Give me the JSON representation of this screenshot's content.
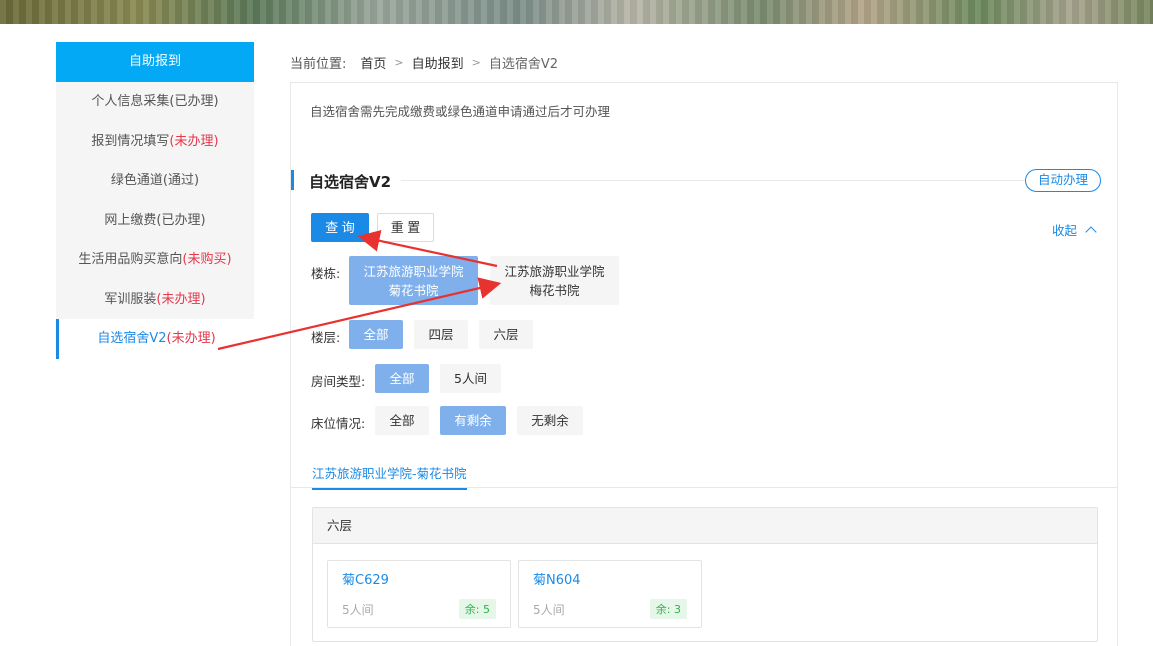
{
  "sidebar": {
    "header": "自助报到",
    "items": [
      {
        "label": "个人信息采集",
        "status": "(已办理)",
        "status_red": false
      },
      {
        "label": "报到情况填写",
        "status": "(未办理)",
        "status_red": true
      },
      {
        "label": "绿色通道",
        "status": "(通过)",
        "status_red": false
      },
      {
        "label": "网上缴费",
        "status": "(已办理)",
        "status_red": false
      },
      {
        "label": "生活用品购买意向",
        "status": "(未购买)",
        "status_red": true
      },
      {
        "label": "军训服装",
        "status": "(未办理)",
        "status_red": true
      },
      {
        "label": "自选宿舍V2",
        "status": "(未办理)",
        "status_red": true
      }
    ]
  },
  "breadcrumb": {
    "prefix": "当前位置:",
    "items": [
      "首页",
      "自助报到",
      "自选宿舍V2"
    ]
  },
  "notice": "自选宿舍需先完成缴费或绿色通道申请通过后才可办理",
  "section": {
    "title": "自选宿舍V2",
    "auto_button": "自动办理"
  },
  "actions": {
    "query": "查 询",
    "reset": "重 置",
    "collapse": "收起"
  },
  "filters": {
    "building": {
      "label": "楼栋:",
      "options": [
        {
          "line1": "江苏旅游职业学院",
          "line2": "菊花书院",
          "selected": true
        },
        {
          "line1": "江苏旅游职业学院",
          "line2": "梅花书院",
          "selected": false
        }
      ]
    },
    "floor": {
      "label": "楼层:",
      "options": [
        {
          "text": "全部",
          "selected": true
        },
        {
          "text": "四层",
          "selected": false
        },
        {
          "text": "六层",
          "selected": false
        }
      ]
    },
    "room_type": {
      "label": "房间类型:",
      "options": [
        {
          "text": "全部",
          "selected": true
        },
        {
          "text": "5人间",
          "selected": false
        }
      ]
    },
    "bed_status": {
      "label": "床位情况:",
      "options": [
        {
          "text": "全部",
          "selected": false
        },
        {
          "text": "有剩余",
          "selected": true
        },
        {
          "text": "无剩余",
          "selected": false
        }
      ]
    }
  },
  "result_tab": "江苏旅游职业学院-菊花书院",
  "floor_group": {
    "name": "六层",
    "rooms": [
      {
        "name": "菊C629",
        "type": "5人间",
        "free": "余: 5"
      },
      {
        "name": "菊N604",
        "type": "5人间",
        "free": "余: 3"
      }
    ]
  },
  "colors": {
    "primary": "#1b8ae6",
    "sidebar_header": "#03a9f4",
    "selected_chip": "#7fb0ec",
    "status_red": "#e6374b",
    "annotation_arrow": "#e8322f",
    "free_badge": "#2db24a"
  }
}
